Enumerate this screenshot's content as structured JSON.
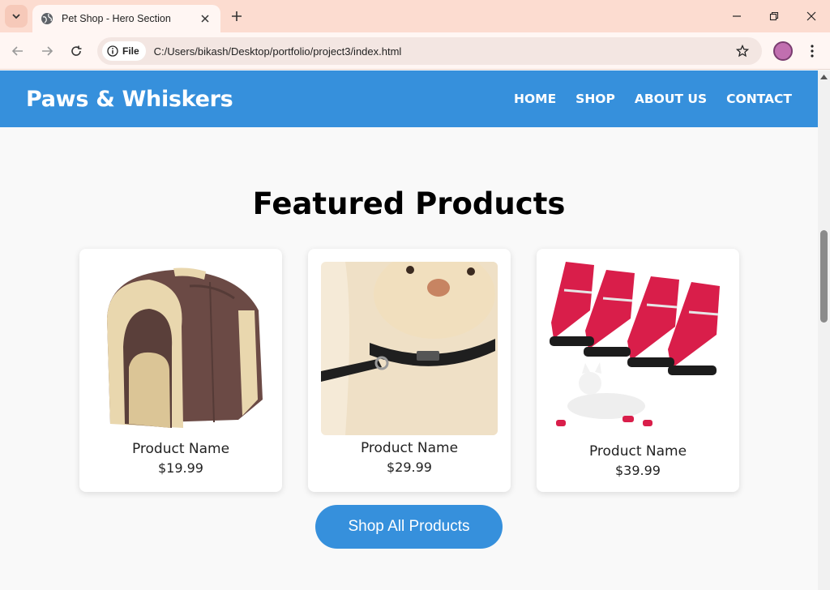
{
  "browser": {
    "tab_title": "Pet Shop - Hero Section",
    "site_chip": "File",
    "url": "C:/Users/bikash/Desktop/portfolio/project3/index.html"
  },
  "site": {
    "brand": "Paws & Whiskers",
    "nav": [
      "HOME",
      "SHOP",
      "ABOUT US",
      "CONTACT"
    ],
    "section_title": "Featured Products",
    "products": [
      {
        "name": "Product Name",
        "price": "$19.99",
        "image": "pet-house-image"
      },
      {
        "name": "Product Name",
        "price": "$29.99",
        "image": "dog-collar-image"
      },
      {
        "name": "Product Name",
        "price": "$39.99",
        "image": "dog-boots-image"
      }
    ],
    "cta": "Shop All Products"
  },
  "colors": {
    "header": "#3690dc",
    "button": "#3690dc",
    "tabstrip": "#fcdcd0",
    "page_bg": "#f9f9f9"
  }
}
